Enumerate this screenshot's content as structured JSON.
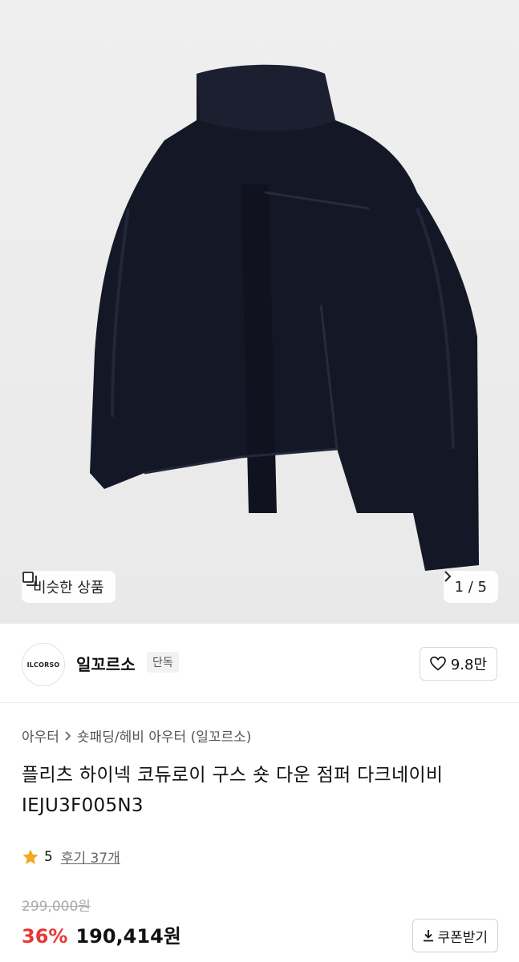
{
  "gallery": {
    "similar_label": "비슷한 상품",
    "counter": "1 / 5"
  },
  "brand": {
    "logo_text": "ILCORSO",
    "name": "일꼬르소",
    "badge": "단독",
    "likes": "9.8만"
  },
  "breadcrumb": {
    "level1": "아우터",
    "level2": "숏패딩/헤비 아우터 (일꼬르소)"
  },
  "product": {
    "title": "플리츠 하이넥 코듀로이 구스 숏 다운 점퍼 다크네이비 IEJU3F005N3",
    "rating": "5",
    "reviews": "후기 37개",
    "original_price": "299,000원",
    "discount": "36%",
    "price": "190,414원",
    "coupon_label": "쿠폰받기"
  },
  "colors": {
    "discount": "#e53935",
    "star": "#f5a623",
    "jacket": "#141726"
  },
  "icons": {
    "similar": "similar-items-icon",
    "chevron": "chevron-right-icon",
    "heart": "heart-icon",
    "star": "star-icon",
    "download": "download-icon"
  }
}
